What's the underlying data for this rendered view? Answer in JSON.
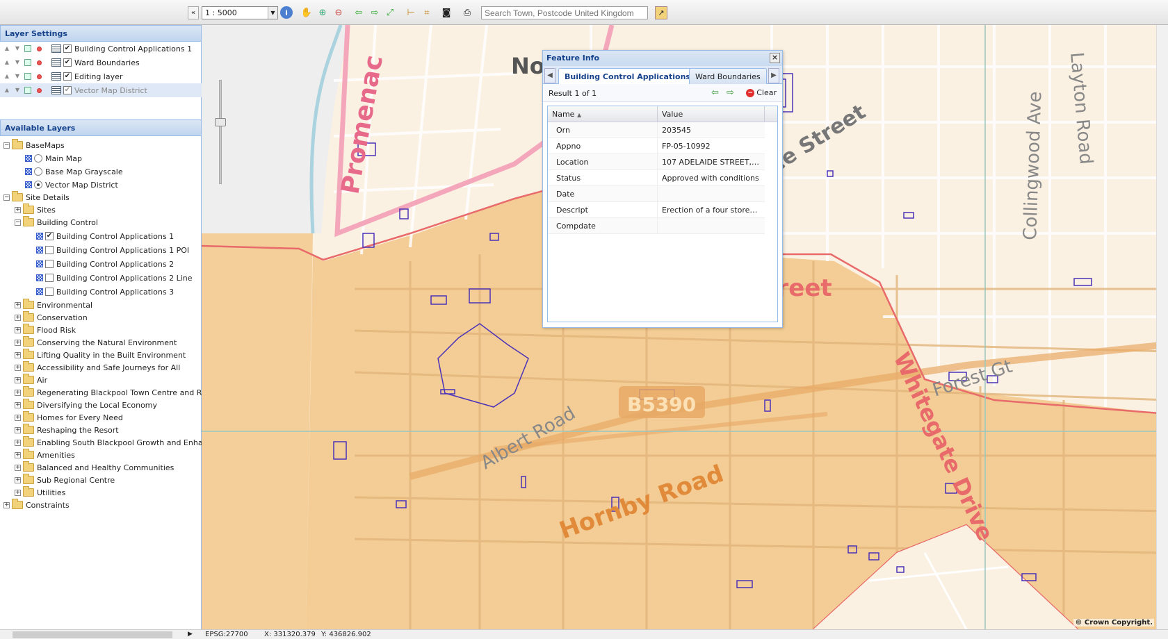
{
  "toolbar": {
    "scale": "1 : 5000",
    "search_placeholder": "Search Town, Postcode United Kingdom"
  },
  "layer_settings": {
    "title": "Layer Settings",
    "layers": [
      {
        "label": "Building Control Applications 1",
        "checked": true
      },
      {
        "label": "Ward Boundaries",
        "checked": true
      },
      {
        "label": "Editing layer",
        "checked": true
      },
      {
        "label": "Vector Map District",
        "checked": true,
        "selected": true
      }
    ]
  },
  "available_layers": {
    "title": "Available Layers",
    "basemaps": {
      "label": "BaseMaps",
      "items": [
        {
          "label": "Main Map",
          "selected": false
        },
        {
          "label": "Base Map Grayscale",
          "selected": false
        },
        {
          "label": "Vector Map District",
          "selected": true
        }
      ]
    },
    "site_details": {
      "label": "Site Details",
      "sites_label": "Sites",
      "building_control": {
        "label": "Building Control",
        "items": [
          {
            "label": "Building Control Applications 1",
            "checked": true
          },
          {
            "label": "Building Control Applications 1 POI",
            "checked": false
          },
          {
            "label": "Building Control Applications 2",
            "checked": false
          },
          {
            "label": "Building Control Applications 2 Line",
            "checked": false
          },
          {
            "label": "Building Control Applications 3",
            "checked": false
          }
        ]
      },
      "groups": [
        "Environmental",
        "Conservation",
        "Flood Risk",
        "Conserving the Natural Environment",
        "Lifting Quality in the Built Environment",
        "Accessibility and Safe Journeys for All",
        "Air",
        "Regenerating Blackpool Town Centre and Resort",
        "Diversifying the Local Economy",
        "Homes for Every Need",
        "Reshaping the Resort",
        "Enabling South Blackpool Growth and Enhancen",
        "Amenities",
        "Balanced and Healthy Communities",
        "Sub Regional Centre",
        "Utilities"
      ]
    },
    "constraints_label": "Constraints"
  },
  "feature_info": {
    "title": "Feature Info",
    "tabs": [
      "Building Control Applications 1",
      "Ward Boundaries"
    ],
    "result_text": "Result 1 of 1",
    "clear_label": "Clear",
    "columns": [
      "Name",
      "Value"
    ],
    "rows": [
      {
        "name": "Orn",
        "value": "203545"
      },
      {
        "name": "Appno",
        "value": "FP-05-10992"
      },
      {
        "name": "Location",
        "value": "107 ADELAIDE STREET, B..."
      },
      {
        "name": "Status",
        "value": "Approved with conditions"
      },
      {
        "name": "Date",
        "value": ""
      },
      {
        "name": "Descript",
        "value": "Erection of a four storey bui..."
      },
      {
        "name": "Compdate",
        "value": ""
      }
    ]
  },
  "map": {
    "labels": {
      "promenade": "Promenac",
      "north": "North",
      "street1": "unce Street",
      "street2": "rStreet",
      "albert_road": "Albert Road",
      "hornby_road": "Hornby Road",
      "road_code": "B5390",
      "whitegate": "Whitegate Drive",
      "forest": "Forest Gt",
      "collingwood": "Collingwood Ave",
      "layton": "Layton Road"
    },
    "copyright": "© Crown Copyright."
  },
  "status": {
    "epsg": "EPSG:27700",
    "x": "X: 331320.379",
    "y": "Y: 436826.902"
  },
  "colors": {
    "ward_fill": "#f2c98c",
    "ward_border": "#e86a6a",
    "street": "#e9c9a3",
    "water": "#aad3df",
    "land": "#fbf1e3",
    "panel_header": "#c1d5ef"
  }
}
